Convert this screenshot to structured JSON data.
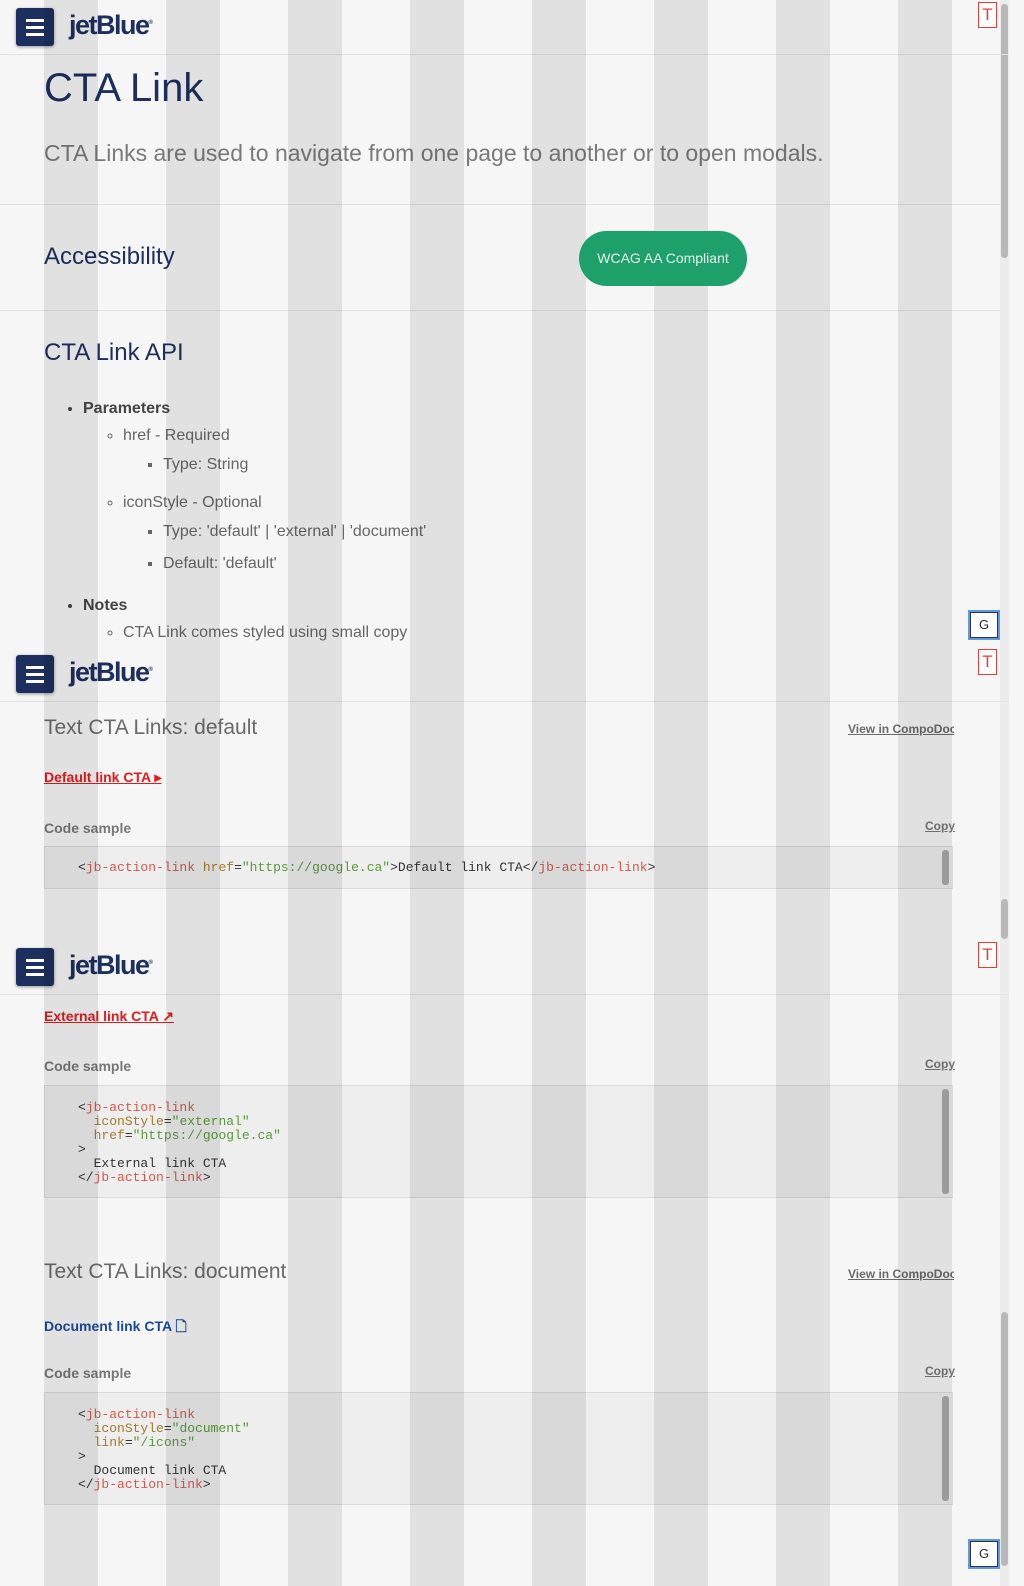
{
  "header": {
    "logo": "jetBlue",
    "logo_mark": "®",
    "t_marker": "T",
    "g_marker": "G"
  },
  "page": {
    "title": "CTA Link",
    "lead": "CTA Links are used to navigate from one page to another or to open modals."
  },
  "accessibility": {
    "heading": "Accessibility",
    "badge": "WCAG AA Compliant"
  },
  "api": {
    "heading": "CTA Link API",
    "parameters_label": "Parameters",
    "href": "href - Required",
    "href_type": "Type: String",
    "iconstyle": "iconStyle - Optional",
    "iconstyle_type": "Type: 'default' | 'external' | 'document'",
    "iconstyle_default": "Default: 'default'",
    "notes_label": "Notes",
    "notes_partial": "CTA Link comes styled using small copy"
  },
  "default_section": {
    "title": "Text CTA Links: default",
    "compodoc": "View in CompoDoc",
    "link": "Default link CTA",
    "code_label": "Code sample",
    "copy": "Copy",
    "code": {
      "open": "<",
      "tag": "jb-action-link",
      "attr": "href",
      "eq": "=",
      "val": "\"https://google.ca\"",
      "mid": ">Default link CTA</",
      "close": ">"
    }
  },
  "external_section": {
    "link": "External link CTA",
    "code_label": "Code sample",
    "copy": "Copy",
    "code": {
      "l1_open": "<",
      "l1_tag": "jb-action-link",
      "l2_attr": "iconStyle",
      "l2_val": "\"external\"",
      "l3_attr": "href",
      "l3_val": "\"https://google.ca\"",
      "l4": ">",
      "l5": "External link CTA",
      "l6_open": "</",
      "l6_tag": "jb-action-link",
      "l6_close": ">"
    }
  },
  "document_section": {
    "title": "Text CTA Links: document",
    "compodoc": "View in CompoDoc",
    "link": "Document link CTA",
    "code_label": "Code sample",
    "copy": "Copy",
    "code": {
      "l1_open": "<",
      "l1_tag": "jb-action-link",
      "l2_attr": "iconStyle",
      "l2_val": "\"document\"",
      "l3_attr": "link",
      "l3_val": "\"/icons\"",
      "l4": ">",
      "l5": "Document link CTA",
      "l6_open": "</",
      "l6_tag": "jb-action-link",
      "l6_close": ">"
    }
  }
}
